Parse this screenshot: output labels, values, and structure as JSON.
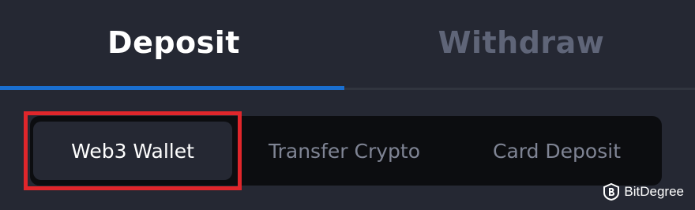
{
  "tabs": {
    "deposit_label": "Deposit",
    "withdraw_label": "Withdraw",
    "active": "Deposit"
  },
  "methods": {
    "web3_label": "Web3 Wallet",
    "transfer_label": "Transfer Crypto",
    "card_label": "Card Deposit",
    "selected": "Web3 Wallet"
  },
  "watermark": {
    "text": "BitDegree",
    "icon": "bitdegree-logo-icon"
  },
  "colors": {
    "accent": "#1a6fd0",
    "highlight": "#e0262b",
    "background": "#252833"
  }
}
